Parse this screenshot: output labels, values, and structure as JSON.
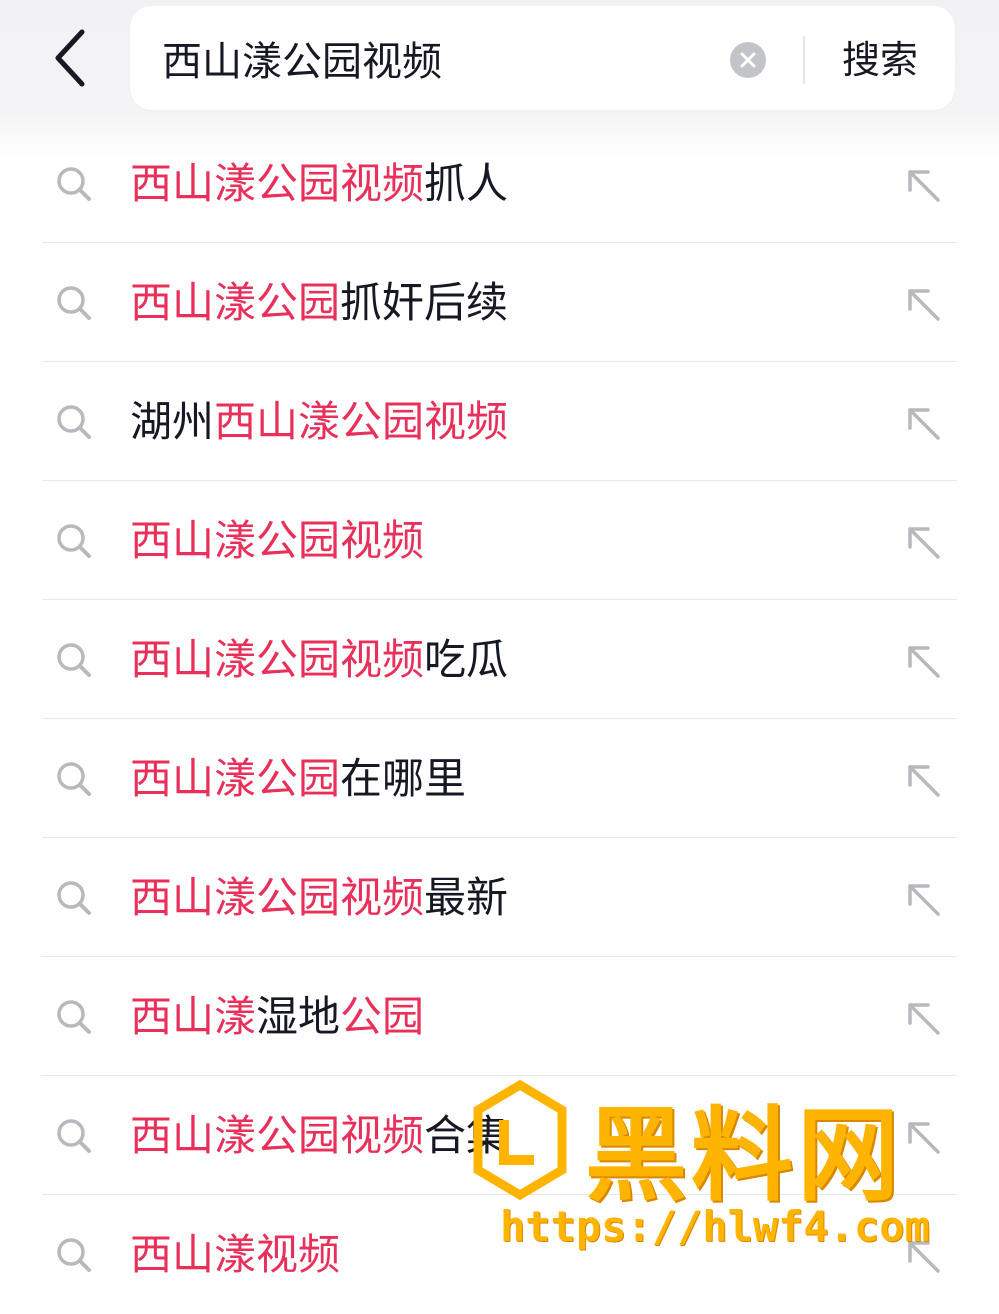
{
  "header": {
    "search_value": "西山漾公园视频",
    "search_button_label": "搜索"
  },
  "suggestions": [
    {
      "parts": [
        {
          "text": "西山漾公园视频",
          "hl": true
        },
        {
          "text": "抓人",
          "hl": false
        }
      ]
    },
    {
      "parts": [
        {
          "text": "西山漾公园",
          "hl": true
        },
        {
          "text": "抓奸后续",
          "hl": false
        }
      ]
    },
    {
      "parts": [
        {
          "text": "湖州",
          "hl": false
        },
        {
          "text": "西山漾公园视频",
          "hl": true
        }
      ]
    },
    {
      "parts": [
        {
          "text": "西山漾公园视频",
          "hl": true
        }
      ]
    },
    {
      "parts": [
        {
          "text": "西山漾公园视频",
          "hl": true
        },
        {
          "text": "吃瓜",
          "hl": false
        }
      ]
    },
    {
      "parts": [
        {
          "text": "西山漾公园",
          "hl": true
        },
        {
          "text": "在哪里",
          "hl": false
        }
      ]
    },
    {
      "parts": [
        {
          "text": "西山漾公园视频",
          "hl": true
        },
        {
          "text": "最新",
          "hl": false
        }
      ]
    },
    {
      "parts": [
        {
          "text": "西山漾",
          "hl": true
        },
        {
          "text": "湿地",
          "hl": false
        },
        {
          "text": "公园",
          "hl": true
        }
      ]
    },
    {
      "parts": [
        {
          "text": "西山漾公园视频",
          "hl": true
        },
        {
          "text": "合集",
          "hl": false
        }
      ]
    },
    {
      "parts": [
        {
          "text": "西山漾视频",
          "hl": true
        }
      ]
    }
  ],
  "icons": {
    "back": "chevron-left-icon",
    "clear": "clear-circle-icon",
    "suggestion": "search-icon",
    "fill": "arrow-up-left-icon"
  },
  "colors": {
    "highlight": "#e8305a",
    "text": "#161823",
    "icon": "#b8b9bd",
    "watermark": "#ffb400"
  },
  "watermark": {
    "title": "黑料网",
    "url": "https://hlwf4.com"
  }
}
